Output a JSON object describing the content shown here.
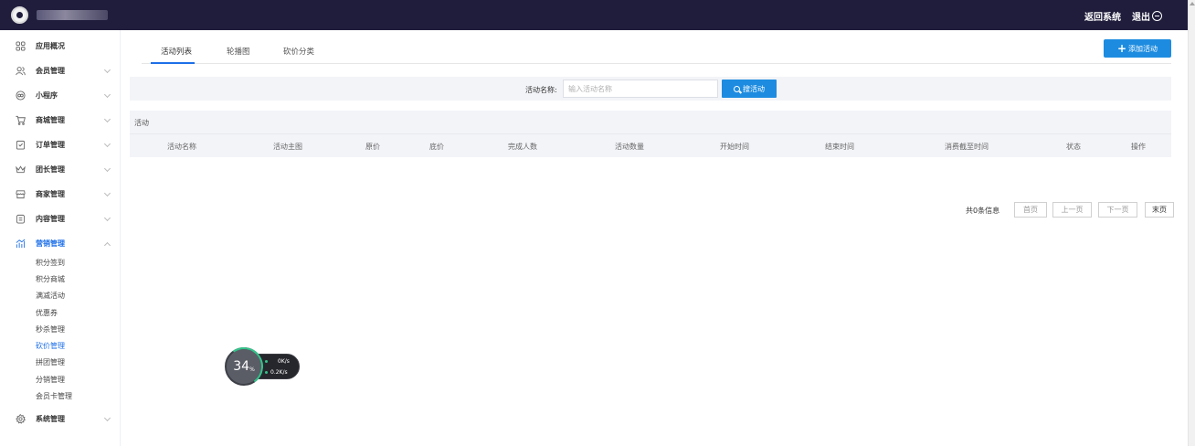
{
  "topbar": {
    "back_label": "返回系统",
    "logout_label": "退出"
  },
  "sidebar": {
    "items": [
      {
        "label": "应用概况",
        "icon": "grid-icon"
      },
      {
        "label": "会员管理",
        "icon": "users-icon"
      },
      {
        "label": "小程序",
        "icon": "mini-program-icon"
      },
      {
        "label": "商城管理",
        "icon": "cart-icon"
      },
      {
        "label": "订单管理",
        "icon": "order-icon"
      },
      {
        "label": "团长管理",
        "icon": "crown-icon"
      },
      {
        "label": "商家管理",
        "icon": "store-icon"
      },
      {
        "label": "内容管理",
        "icon": "content-icon"
      },
      {
        "label": "营销管理",
        "icon": "chart-icon"
      },
      {
        "label": "系统管理",
        "icon": "gear-icon"
      }
    ],
    "marketing_sub": [
      "积分签到",
      "积分商城",
      "满减活动",
      "优惠券",
      "秒杀管理",
      "砍价管理",
      "拼团管理",
      "分销管理",
      "会员卡管理"
    ]
  },
  "tabs": [
    "活动列表",
    "轮播图",
    "砍价分类"
  ],
  "add_button": {
    "label": "添加活动"
  },
  "search": {
    "label": "活动名称:",
    "placeholder": "输入活动名称",
    "button": "搜活动"
  },
  "table": {
    "caption": "活动",
    "columns": [
      "活动名称",
      "活动主图",
      "原价",
      "底价",
      "完成人数",
      "活动数量",
      "开始时间",
      "结束时间",
      "消费截至时间",
      "状态",
      "操作"
    ]
  },
  "pagination": {
    "info": "共0条信息",
    "first": "首页",
    "prev": "上一页",
    "next": "下一页",
    "last": "末页"
  },
  "widget": {
    "percent": "34",
    "unit": "%",
    "up": "0K/s",
    "down": "0.2K/s"
  },
  "colors": {
    "accent": "#1d8ce0",
    "topbar": "#201d3c",
    "active_menu": "#1d6fe8"
  }
}
